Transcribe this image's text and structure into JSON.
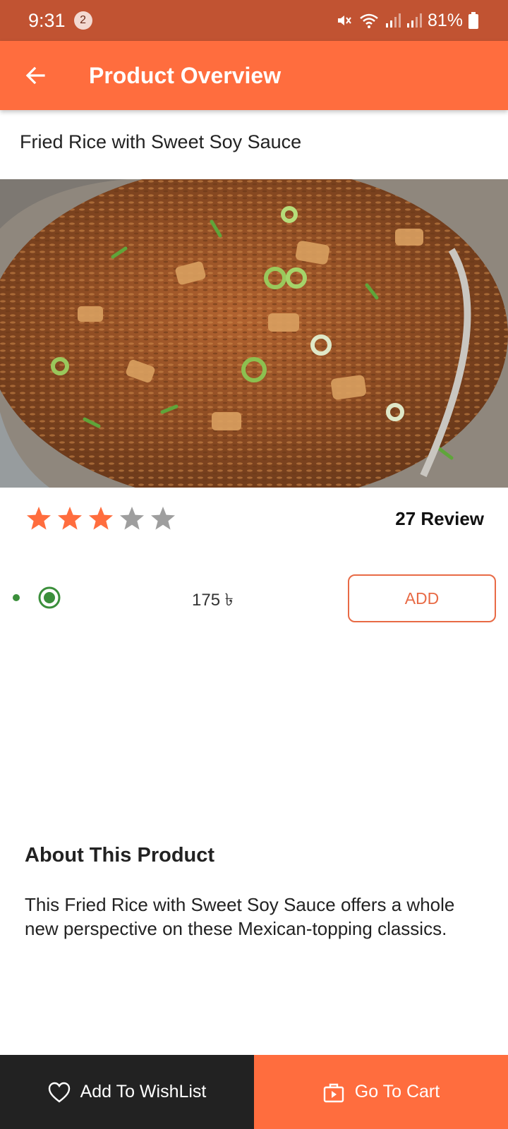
{
  "status_bar": {
    "time": "9:31",
    "notification_count": "2",
    "battery": "81%"
  },
  "app_bar": {
    "title": "Product Overview",
    "back_icon": "arrow-back-icon"
  },
  "product": {
    "name": "Fried Rice with Sweet Soy Sauce",
    "image_icon": "fried-rice-photo",
    "rating": 3,
    "rating_max": 5,
    "review_label": "27 Review",
    "price": "175 ৳",
    "add_label": "ADD"
  },
  "about": {
    "title": "About This Product",
    "text": "This Fried Rice with Sweet Soy Sauce offers a whole new perspective on these Mexican-topping classics."
  },
  "bottom_bar": {
    "wishlist_label": "Add To WishList",
    "cart_label": "Go To Cart"
  },
  "colors": {
    "status_bar": "#C15332",
    "accent": "#FF6D3E",
    "star_filled": "#FF6D3E",
    "star_empty": "#9E9E9E",
    "radio": "#3B8F3B",
    "dark_button": "#222222"
  }
}
